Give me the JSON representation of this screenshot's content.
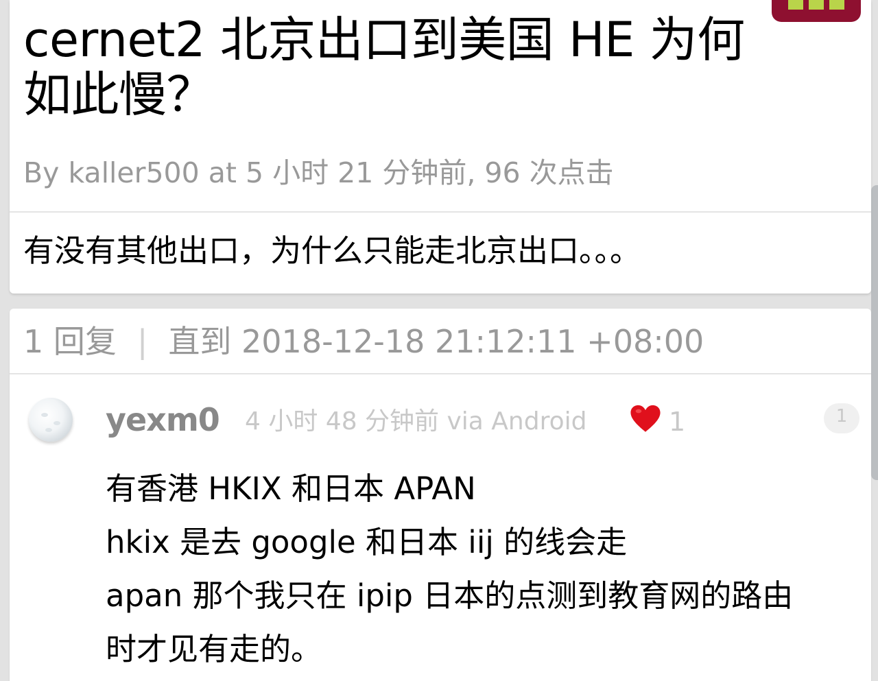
{
  "topic": {
    "title": "cernet2 北京出口到美国 HE 为何如此慢？",
    "meta_by": "By",
    "meta_author": "kaller500",
    "meta_rest": "at 5 小时 21 分钟前, 96 次点击",
    "content": "有没有其他出口，为什么只能走北京出口。。。"
  },
  "replies_header": {
    "count_label": "1 回复",
    "separator": "|",
    "until_label": "直到 2018-12-18 21:12:11 +08:00"
  },
  "replies": [
    {
      "author": "yexm0",
      "time": "4 小时 48 分钟前 via Android",
      "likes": "1",
      "floor": "1",
      "lines": [
        "有香港 HKIX 和日本 APAN",
        "hkix 是去 google 和日本 iij 的线会走",
        "apan 那个我只在 ipip 日本的点测到教育网的路由",
        "时才见有走的。"
      ]
    }
  ],
  "icons": {
    "heart": "heart-icon",
    "avatar_big": "op-avatar",
    "avatar_reply": "reply-avatar"
  },
  "colors": {
    "heart": "#e0101c",
    "op_avatar_bg": "#8e1030",
    "op_avatar_fg": "#b9d44a",
    "muted_text": "#999999"
  }
}
